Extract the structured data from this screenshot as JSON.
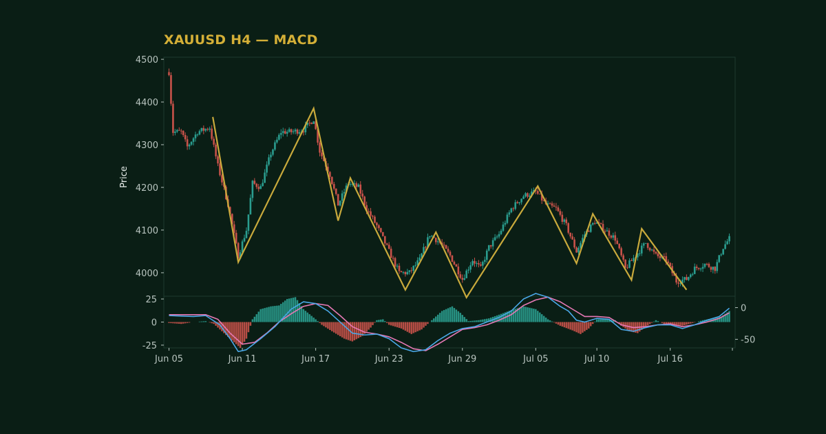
{
  "colors": {
    "background": "#0a1e15",
    "panel_border": "#1d3a30",
    "up": "#2a9d8f",
    "down": "#c9524a",
    "zigzag": "#c9aa3c",
    "macd_line": "#4aa8e8",
    "signal_line": "#e779b6",
    "tick_text": "#b8c4bf",
    "title": "#d4af37"
  },
  "chart_data": {
    "type": "candlestick",
    "title": "XAUUSD H4 — MACD",
    "ylabel": "Price",
    "price_ylim": [
      3945,
      4505
    ],
    "price_ticks": [
      4000,
      4100,
      4200,
      4300,
      4400,
      4500
    ],
    "macd_left_ylim": [
      -28,
      28
    ],
    "macd_left_ticks": [
      25,
      0,
      -25
    ],
    "macd_right_ylim": [
      -63.5,
      18
    ],
    "macd_right_ticks": [
      0,
      -50
    ],
    "x_tick_labels": [
      {
        "date": "2025-06-05",
        "label": "Jun 05"
      },
      {
        "date": "2025-06-11",
        "label": "Jun 11"
      },
      {
        "date": "2025-06-17",
        "label": "Jun 17"
      },
      {
        "date": "2025-06-23",
        "label": "Jun 23"
      },
      {
        "date": "2025-06-29",
        "label": "Jun 29"
      },
      {
        "date": "2025-07-05",
        "label": "Jul 05"
      },
      {
        "date": "2025-07-10",
        "label": "Jul 10"
      },
      {
        "date": "2025-07-16",
        "label": "Jul 16"
      }
    ],
    "x_range": [
      "2025-06-05T00:00",
      "2025-07-21T00:00"
    ],
    "close_path": [
      [
        "2025-06-05T00:00",
        4470
      ],
      [
        "2025-06-05T08:00",
        4330
      ],
      [
        "2025-06-06T00:00",
        4330
      ],
      [
        "2025-06-06T12:00",
        4295
      ],
      [
        "2025-06-07T08:00",
        4330
      ],
      [
        "2025-06-08T08:00",
        4340
      ],
      [
        "2025-06-09T00:00",
        4250
      ],
      [
        "2025-06-09T20:00",
        4160
      ],
      [
        "2025-06-10T16:00",
        4040
      ],
      [
        "2025-06-11T08:00",
        4100
      ],
      [
        "2025-06-11T20:00",
        4210
      ],
      [
        "2025-06-12T12:00",
        4200
      ],
      [
        "2025-06-13T08:00",
        4280
      ],
      [
        "2025-06-14T04:00",
        4330
      ],
      [
        "2025-06-15T00:00",
        4330
      ],
      [
        "2025-06-16T00:00",
        4335
      ],
      [
        "2025-06-16T20:00",
        4360
      ],
      [
        "2025-06-17T08:00",
        4285
      ],
      [
        "2025-06-18T04:00",
        4230
      ],
      [
        "2025-06-18T20:00",
        4160
      ],
      [
        "2025-06-19T16:00",
        4210
      ],
      [
        "2025-06-20T12:00",
        4200
      ],
      [
        "2025-06-21T04:00",
        4150
      ],
      [
        "2025-06-22T00:00",
        4110
      ],
      [
        "2025-06-22T20:00",
        4060
      ],
      [
        "2025-06-23T20:00",
        4000
      ],
      [
        "2025-06-24T16:00",
        4000
      ],
      [
        "2025-06-25T12:00",
        4030
      ],
      [
        "2025-06-26T08:00",
        4090
      ],
      [
        "2025-06-27T04:00",
        4070
      ],
      [
        "2025-06-28T00:00",
        4040
      ],
      [
        "2025-06-29T00:00",
        3985
      ],
      [
        "2025-06-29T20:00",
        4030
      ],
      [
        "2025-06-30T12:00",
        4010
      ],
      [
        "2025-07-01T04:00",
        4060
      ],
      [
        "2025-07-02T00:00",
        4090
      ],
      [
        "2025-07-03T00:00",
        4150
      ],
      [
        "2025-07-04T00:00",
        4180
      ],
      [
        "2025-07-05T00:00",
        4190
      ],
      [
        "2025-07-05T20:00",
        4160
      ],
      [
        "2025-07-06T16:00",
        4150
      ],
      [
        "2025-07-07T12:00",
        4110
      ],
      [
        "2025-07-08T08:00",
        4050
      ],
      [
        "2025-07-09T00:00",
        4090
      ],
      [
        "2025-07-09T20:00",
        4120
      ],
      [
        "2025-07-10T16:00",
        4100
      ],
      [
        "2025-07-11T12:00",
        4080
      ],
      [
        "2025-07-12T08:00",
        4010
      ],
      [
        "2025-07-13T04:00",
        4040
      ],
      [
        "2025-07-14T00:00",
        4070
      ],
      [
        "2025-07-14T20:00",
        4040
      ],
      [
        "2025-07-15T16:00",
        4030
      ],
      [
        "2025-07-16T12:00",
        3980
      ],
      [
        "2025-07-17T08:00",
        3985
      ],
      [
        "2025-07-18T00:00",
        4010
      ],
      [
        "2025-07-18T20:00",
        4020
      ],
      [
        "2025-07-19T16:00",
        4010
      ],
      [
        "2025-07-20T08:00",
        4060
      ],
      [
        "2025-07-20T20:00",
        4080
      ]
    ],
    "zigzag": [
      [
        "2025-06-08T14:00",
        4365
      ],
      [
        "2025-06-10T16:00",
        4025
      ],
      [
        "2025-06-16T20:00",
        4385
      ],
      [
        "2025-06-18T20:00",
        4122
      ],
      [
        "2025-06-19T20:00",
        4222
      ],
      [
        "2025-06-24T08:00",
        3960
      ],
      [
        "2025-06-26T20:00",
        4095
      ],
      [
        "2025-06-29T08:00",
        3942
      ],
      [
        "2025-07-05T04:00",
        4203
      ],
      [
        "2025-07-08T08:00",
        4022
      ],
      [
        "2025-07-09T16:00",
        4138
      ],
      [
        "2025-07-12T20:00",
        3983
      ],
      [
        "2025-07-13T16:00",
        4103
      ],
      [
        "2025-07-17T08:00",
        3960
      ]
    ],
    "macd_line": [
      [
        "2025-06-05T00:00",
        7
      ],
      [
        "2025-06-07T00:00",
        6
      ],
      [
        "2025-06-08T00:00",
        7
      ],
      [
        "2025-06-09T04:00",
        -3
      ],
      [
        "2025-06-10T00:00",
        -18
      ],
      [
        "2025-06-10T16:00",
        -32
      ],
      [
        "2025-06-11T08:00",
        -30
      ],
      [
        "2025-06-12T12:00",
        -18
      ],
      [
        "2025-06-13T16:00",
        -5
      ],
      [
        "2025-06-15T00:00",
        14
      ],
      [
        "2025-06-16T00:00",
        22
      ],
      [
        "2025-06-17T00:00",
        20
      ],
      [
        "2025-06-18T00:00",
        12
      ],
      [
        "2025-06-19T04:00",
        -2
      ],
      [
        "2025-06-20T00:00",
        -12
      ],
      [
        "2025-06-21T00:00",
        -14
      ],
      [
        "2025-06-22T00:00",
        -13
      ],
      [
        "2025-06-23T00:00",
        -18
      ],
      [
        "2025-06-24T00:00",
        -28
      ],
      [
        "2025-06-25T00:00",
        -32
      ],
      [
        "2025-06-26T00:00",
        -30
      ],
      [
        "2025-06-27T00:00",
        -20
      ],
      [
        "2025-06-28T00:00",
        -12
      ],
      [
        "2025-06-29T00:00",
        -7
      ],
      [
        "2025-06-30T00:00",
        -5
      ],
      [
        "2025-07-01T00:00",
        0
      ],
      [
        "2025-07-02T00:00",
        5
      ],
      [
        "2025-07-03T00:00",
        12
      ],
      [
        "2025-07-04T00:00",
        25
      ],
      [
        "2025-07-05T00:00",
        31
      ],
      [
        "2025-07-06T00:00",
        27
      ],
      [
        "2025-07-07T00:00",
        17
      ],
      [
        "2025-07-07T16:00",
        12
      ],
      [
        "2025-07-08T08:00",
        2
      ],
      [
        "2025-07-09T00:00",
        0
      ],
      [
        "2025-07-10T00:00",
        4
      ],
      [
        "2025-07-11T00:00",
        3
      ],
      [
        "2025-07-12T00:00",
        -8
      ],
      [
        "2025-07-13T00:00",
        -10
      ],
      [
        "2025-07-14T00:00",
        -6
      ],
      [
        "2025-07-15T00:00",
        -3
      ],
      [
        "2025-07-16T00:00",
        -3
      ],
      [
        "2025-07-17T00:00",
        -7
      ],
      [
        "2025-07-18T00:00",
        -3
      ],
      [
        "2025-07-19T00:00",
        2
      ],
      [
        "2025-07-20T00:00",
        6
      ],
      [
        "2025-07-20T20:00",
        15
      ]
    ],
    "signal_line": [
      [
        "2025-06-05T00:00",
        8
      ],
      [
        "2025-06-08T00:00",
        8
      ],
      [
        "2025-06-09T00:00",
        3
      ],
      [
        "2025-06-10T00:00",
        -12
      ],
      [
        "2025-06-11T00:00",
        -24
      ],
      [
        "2025-06-12T00:00",
        -22
      ],
      [
        "2025-06-13T00:00",
        -12
      ],
      [
        "2025-06-14T00:00",
        0
      ],
      [
        "2025-06-15T00:00",
        9
      ],
      [
        "2025-06-16T00:00",
        17
      ],
      [
        "2025-06-17T00:00",
        20
      ],
      [
        "2025-06-18T00:00",
        18
      ],
      [
        "2025-06-19T00:00",
        7
      ],
      [
        "2025-06-20T00:00",
        -5
      ],
      [
        "2025-06-21T00:00",
        -11
      ],
      [
        "2025-06-22T00:00",
        -13
      ],
      [
        "2025-06-23T00:00",
        -16
      ],
      [
        "2025-06-24T00:00",
        -22
      ],
      [
        "2025-06-25T00:00",
        -29
      ],
      [
        "2025-06-26T00:00",
        -31
      ],
      [
        "2025-06-27T00:00",
        -24
      ],
      [
        "2025-06-28T00:00",
        -16
      ],
      [
        "2025-06-29T00:00",
        -8
      ],
      [
        "2025-06-30T00:00",
        -6
      ],
      [
        "2025-07-01T00:00",
        -3
      ],
      [
        "2025-07-02T00:00",
        2
      ],
      [
        "2025-07-03T00:00",
        8
      ],
      [
        "2025-07-04T00:00",
        18
      ],
      [
        "2025-07-05T00:00",
        24
      ],
      [
        "2025-07-06T00:00",
        27
      ],
      [
        "2025-07-07T00:00",
        22
      ],
      [
        "2025-07-08T00:00",
        14
      ],
      [
        "2025-07-09T00:00",
        6
      ],
      [
        "2025-07-10T00:00",
        6
      ],
      [
        "2025-07-11T00:00",
        5
      ],
      [
        "2025-07-12T00:00",
        -3
      ],
      [
        "2025-07-13T00:00",
        -6
      ],
      [
        "2025-07-14T00:00",
        -5
      ],
      [
        "2025-07-15T00:00",
        -3
      ],
      [
        "2025-07-16T00:00",
        -2
      ],
      [
        "2025-07-17T00:00",
        -5
      ],
      [
        "2025-07-18T00:00",
        -3
      ],
      [
        "2025-07-19T00:00",
        0
      ],
      [
        "2025-07-20T00:00",
        4
      ],
      [
        "2025-07-20T20:00",
        10
      ]
    ],
    "histogram_path": [
      [
        "2025-06-05T00:00",
        -1
      ],
      [
        "2025-06-06T00:00",
        -2
      ],
      [
        "2025-06-07T00:00",
        0
      ],
      [
        "2025-06-08T00:00",
        1
      ],
      [
        "2025-06-08T16:00",
        -2
      ],
      [
        "2025-06-09T12:00",
        -12
      ],
      [
        "2025-06-10T08:00",
        -22
      ],
      [
        "2025-06-10T20:00",
        -28
      ],
      [
        "2025-06-11T08:00",
        -18
      ],
      [
        "2025-06-11T20:00",
        3
      ],
      [
        "2025-06-12T12:00",
        14
      ],
      [
        "2025-06-13T08:00",
        17
      ],
      [
        "2025-06-14T00:00",
        18
      ],
      [
        "2025-06-14T16:00",
        25
      ],
      [
        "2025-06-15T08:00",
        27
      ],
      [
        "2025-06-16T00:00",
        14
      ],
      [
        "2025-06-17T00:00",
        3
      ],
      [
        "2025-06-17T12:00",
        -3
      ],
      [
        "2025-06-18T08:00",
        -10
      ],
      [
        "2025-06-19T08:00",
        -18
      ],
      [
        "2025-06-20T00:00",
        -21
      ],
      [
        "2025-06-20T20:00",
        -15
      ],
      [
        "2025-06-21T12:00",
        -6
      ],
      [
        "2025-06-22T00:00",
        2
      ],
      [
        "2025-06-22T12:00",
        3
      ],
      [
        "2025-06-23T00:00",
        -3
      ],
      [
        "2025-06-24T00:00",
        -7
      ],
      [
        "2025-06-24T20:00",
        -13
      ],
      [
        "2025-06-25T16:00",
        -8
      ],
      [
        "2025-06-26T12:00",
        2
      ],
      [
        "2025-06-27T08:00",
        12
      ],
      [
        "2025-06-28T04:00",
        17
      ],
      [
        "2025-06-28T20:00",
        10
      ],
      [
        "2025-06-29T12:00",
        1
      ],
      [
        "2025-06-30T08:00",
        2
      ],
      [
        "2025-07-01T04:00",
        4
      ],
      [
        "2025-07-02T00:00",
        8
      ],
      [
        "2025-07-03T00:00",
        13
      ],
      [
        "2025-07-04T00:00",
        17
      ],
      [
        "2025-07-05T00:00",
        14
      ],
      [
        "2025-07-06T00:00",
        3
      ],
      [
        "2025-07-07T00:00",
        -4
      ],
      [
        "2025-07-08T00:00",
        -9
      ],
      [
        "2025-07-08T16:00",
        -13
      ],
      [
        "2025-07-09T08:00",
        -7
      ],
      [
        "2025-07-10T00:00",
        3
      ],
      [
        "2025-07-10T20:00",
        3
      ],
      [
        "2025-07-11T12:00",
        2
      ],
      [
        "2025-07-12T00:00",
        -4
      ],
      [
        "2025-07-12T16:00",
        -10
      ],
      [
        "2025-07-13T08:00",
        -12
      ],
      [
        "2025-07-14T00:00",
        -5
      ],
      [
        "2025-07-14T20:00",
        2
      ],
      [
        "2025-07-15T16:00",
        -3
      ],
      [
        "2025-07-16T08:00",
        -3
      ],
      [
        "2025-07-17T00:00",
        -4
      ],
      [
        "2025-07-17T20:00",
        -1
      ],
      [
        "2025-07-18T16:00",
        2
      ],
      [
        "2025-07-19T12:00",
        4
      ],
      [
        "2025-07-20T04:00",
        6
      ],
      [
        "2025-07-20T20:00",
        12
      ]
    ]
  }
}
